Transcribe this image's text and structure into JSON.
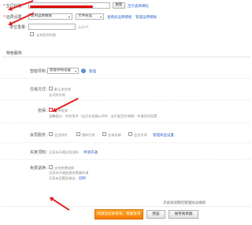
{
  "form": {
    "title_label": "宝贝标题：",
    "title_button": "刷新",
    "title_link": "宝贝类目细化",
    "shipping_label": "运费设置：",
    "shipping_select": "使用运费模板",
    "shipping_type_select": "大件商品",
    "shipping_link1": "查看此运费模板",
    "shipping_link2": "管理运费模板",
    "weight_label": "单位重量：",
    "weight_unit": "公斤/个",
    "weight_checkbox": "支持货到付款"
  },
  "section": {
    "title": "特色服务"
  },
  "services": {
    "smart_label": "智能导购：",
    "smart_select": "智能导购设置",
    "smart_link": "管理",
    "delivery_label": "交易方式：",
    "delivery_option": "默认发货地",
    "delivery_hint": "宝贝所在地",
    "guarantee_label": "担保：",
    "guarantee_option": "支持担保",
    "guarantee_hint": "温馨提示：符合条件（宝贝总金额≥200，宝贝类目为保障）申请及时设置",
    "member_label": "会员服务：",
    "member_opt1": "会员特价",
    "member_opt2": "限时打折",
    "member_opt3": "全场包邮",
    "member_opt4": "会员专享",
    "member_link": "管理商品设置",
    "buyer_label": "买家须知：",
    "buyer_hint": "买家未开通买家须知",
    "buyer_link": "申请开通",
    "free_label": "免费退换：",
    "free_option": "支持免费退换",
    "free_hint1": "买家未开通此服务需要申请",
    "free_hint2": "买家未设置此服务，",
    "free_link": "说明"
  },
  "footer": {
    "notice": "点此阅读网店管理协议规则",
    "submit_button": "同意协议并发布，我要发布",
    "preview_button": "预览",
    "save_button": "保存到草稿"
  },
  "colors": {
    "accent": "#f57c00",
    "link": "#3366cc",
    "annotation": "#e02020"
  }
}
